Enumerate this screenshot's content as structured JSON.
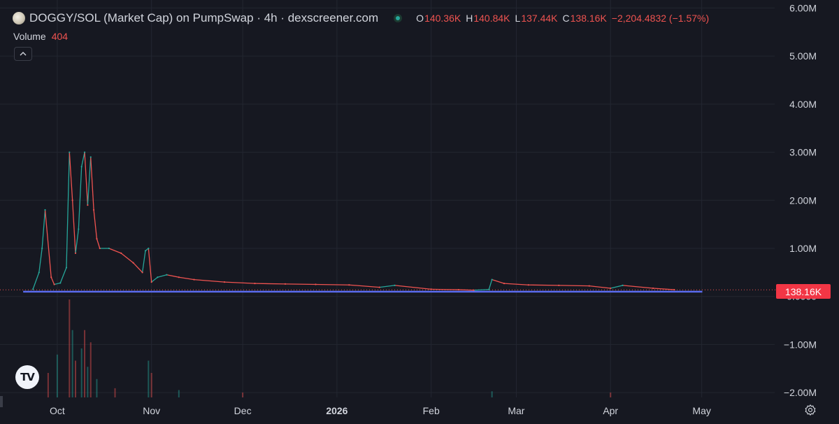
{
  "header": {
    "title": "DOGGY/SOL (Market Cap) on PumpSwap · 4h · dexscreener.com",
    "ohlc": [
      {
        "key": "O",
        "value": "140.36K"
      },
      {
        "key": "H",
        "value": "140.84K"
      },
      {
        "key": "L",
        "value": "137.44K"
      },
      {
        "key": "C",
        "value": "138.16K"
      }
    ],
    "change": "−2,204.4832 (−1.57%)"
  },
  "volume": {
    "label": "Volume",
    "value": "404"
  },
  "collapse_glyph": "^",
  "last_price_label": "138.16K",
  "tv_logo_text": "TV",
  "colors": {
    "background": "#161821",
    "up": "#26a69a",
    "down": "#ef5350",
    "baseline": "#5b6cf0",
    "grid": "#232631",
    "price_tag": "#f23645"
  },
  "icons": [
    "token-logo-icon",
    "status-dot-icon",
    "collapse-chevron-icon",
    "tradingview-logo-icon",
    "settings-gear-icon"
  ],
  "chart_data": {
    "type": "line",
    "title": "DOGGY/SOL (Market Cap) on PumpSwap · 4h · dexscreener.com",
    "y_axis": {
      "ticks": [
        "6.00M",
        "5.00M",
        "4.00M",
        "3.00M",
        "2.00M",
        "1.00M",
        "0.0000",
        "−1.00M",
        "−2.00M"
      ],
      "tick_values": [
        6000000,
        5000000,
        4000000,
        3000000,
        2000000,
        1000000,
        0,
        -1000000,
        -2000000
      ],
      "range": [
        -2100000,
        6050000
      ]
    },
    "x_axis": {
      "ticks": [
        {
          "label": "Oct",
          "date": "2025-10-01"
        },
        {
          "label": "Nov",
          "date": "2025-11-01"
        },
        {
          "label": "Dec",
          "date": "2025-12-01"
        },
        {
          "label": "2026",
          "date": "2026-01-01",
          "bold": true
        },
        {
          "label": "Feb",
          "date": "2026-02-01"
        },
        {
          "label": "Mar",
          "date": "2026-03-01"
        },
        {
          "label": "Apr",
          "date": "2026-04-01"
        },
        {
          "label": "May",
          "date": "2026-05-01"
        }
      ],
      "range": [
        "2025-09-14",
        "2026-05-25"
      ]
    },
    "grid": true,
    "last_price": 138160,
    "market_cap_series": {
      "name": "Market Cap",
      "dates": [
        "2025-09-23",
        "2025-09-25",
        "2025-09-26",
        "2025-09-27",
        "2025-09-29",
        "2025-09-30",
        "2025-10-02",
        "2025-10-04",
        "2025-10-05",
        "2025-10-06",
        "2025-10-07",
        "2025-10-08",
        "2025-10-09",
        "2025-10-10",
        "2025-10-11",
        "2025-10-12",
        "2025-10-13",
        "2025-10-14",
        "2025-10-15",
        "2025-10-18",
        "2025-10-22",
        "2025-10-26",
        "2025-10-29",
        "2025-10-30",
        "2025-10-31",
        "2025-11-01",
        "2025-11-03",
        "2025-11-06",
        "2025-11-10",
        "2025-11-15",
        "2025-11-25",
        "2025-12-05",
        "2025-12-15",
        "2025-12-25",
        "2026-01-05",
        "2026-01-15",
        "2026-01-20",
        "2026-02-01",
        "2026-02-10",
        "2026-02-15",
        "2026-02-20",
        "2026-02-21",
        "2026-02-25",
        "2026-03-05",
        "2026-03-15",
        "2026-03-25",
        "2026-04-01",
        "2026-04-05",
        "2026-04-15",
        "2026-04-22"
      ],
      "values": [
        150000,
        500000,
        1000000,
        1800000,
        400000,
        250000,
        280000,
        600000,
        3000000,
        2000000,
        900000,
        1400000,
        2700000,
        3000000,
        1900000,
        2900000,
        1800000,
        1200000,
        1000000,
        1000000,
        900000,
        700000,
        500000,
        950000,
        1000000,
        300000,
        400000,
        450000,
        400000,
        350000,
        300000,
        270000,
        260000,
        250000,
        240000,
        190000,
        230000,
        150000,
        140000,
        130000,
        145000,
        350000,
        270000,
        240000,
        230000,
        220000,
        170000,
        230000,
        170000,
        140000
      ]
    },
    "volume_series": {
      "name": "Volume",
      "dates": [
        "2025-09-28",
        "2025-10-01",
        "2025-10-05",
        "2025-10-06",
        "2025-10-07",
        "2025-10-09",
        "2025-10-10",
        "2025-10-11",
        "2025-10-12",
        "2025-10-14",
        "2025-10-20",
        "2025-10-31",
        "2025-11-01",
        "2025-11-10",
        "2025-12-01",
        "2026-02-21",
        "2026-04-01"
      ],
      "values": [
        40,
        70,
        160,
        110,
        60,
        80,
        110,
        50,
        90,
        30,
        15,
        60,
        40,
        12,
        8,
        10,
        8
      ]
    }
  }
}
